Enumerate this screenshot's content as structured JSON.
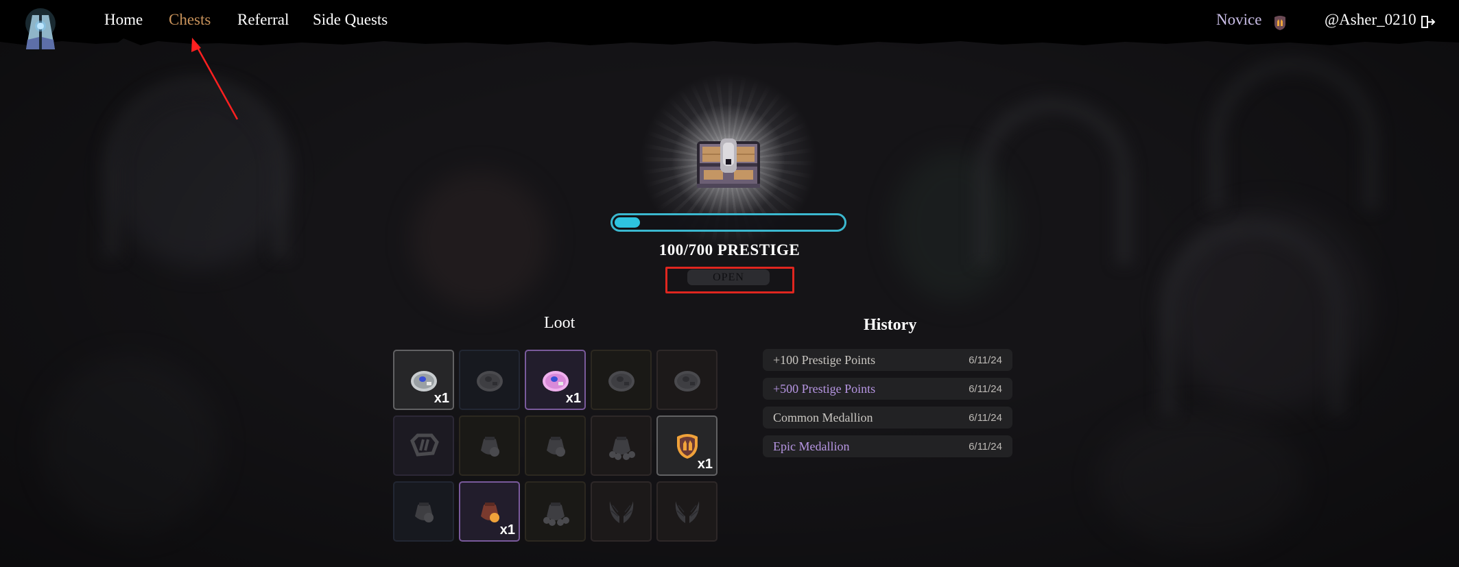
{
  "header": {
    "logo_icon": "pillar-gate-logo-icon",
    "nav": [
      {
        "label": "Home",
        "active": false
      },
      {
        "label": "Chests",
        "active": true
      },
      {
        "label": "Referral",
        "active": false
      },
      {
        "label": "Side Quests",
        "active": false
      }
    ],
    "rank": "Novice",
    "rank_badge_icon": "novice-shield-icon",
    "username": "@Asher_0210",
    "logout_icon": "logout-icon"
  },
  "chest": {
    "icon": "treasure-chest-icon",
    "progress": {
      "current": 100,
      "max": 700,
      "fraction": 0.143
    },
    "prestige_text": "100/700 PRESTIGE",
    "open_label": "OPEN",
    "open_enabled": false
  },
  "loot": {
    "title": "Loot",
    "items": [
      {
        "icon": "common-medallion-icon",
        "owned": true,
        "qty": "x1",
        "rarity": "common"
      },
      {
        "icon": "rare-medallion-icon",
        "owned": false,
        "qty": "",
        "rarity": "rare"
      },
      {
        "icon": "epic-medallion-icon",
        "owned": true,
        "qty": "x1",
        "rarity": "epic"
      },
      {
        "icon": "legendary-medallion-icon",
        "owned": false,
        "qty": "",
        "rarity": "legendary"
      },
      {
        "icon": "mythic-medallion-icon",
        "owned": false,
        "qty": "",
        "rarity": "mythic"
      },
      {
        "icon": "rank-badge-icon",
        "owned": false,
        "qty": "",
        "rarity": "epic"
      },
      {
        "icon": "small-coin-pouch-icon",
        "owned": false,
        "qty": "",
        "rarity": "legendary"
      },
      {
        "icon": "medium-coin-pouch-icon",
        "owned": false,
        "qty": "",
        "rarity": "legendary"
      },
      {
        "icon": "large-coin-pile-icon",
        "owned": false,
        "qty": "",
        "rarity": "mythic"
      },
      {
        "icon": "novice-shield-badge-icon",
        "owned": true,
        "qty": "x1",
        "rarity": "common"
      },
      {
        "icon": "tiny-coin-pouch-icon",
        "owned": false,
        "qty": "",
        "rarity": "rare"
      },
      {
        "icon": "prestige-coin-pouch-icon",
        "owned": true,
        "qty": "x1",
        "rarity": "epic"
      },
      {
        "icon": "coin-sack-pile-icon",
        "owned": false,
        "qty": "",
        "rarity": "legendary"
      },
      {
        "icon": "wings-icon",
        "owned": false,
        "qty": "",
        "rarity": "mythic"
      },
      {
        "icon": "wings-icon",
        "owned": false,
        "qty": "",
        "rarity": "mythic"
      }
    ]
  },
  "history": {
    "title": "History",
    "entries": [
      {
        "label": "+100 Prestige Points",
        "date": "6/11/24",
        "rarity": "common"
      },
      {
        "label": "+500 Prestige Points",
        "date": "6/11/24",
        "rarity": "epic"
      },
      {
        "label": "Common Medallion",
        "date": "6/11/24",
        "rarity": "common"
      },
      {
        "label": "Epic Medallion",
        "date": "6/11/24",
        "rarity": "epic"
      }
    ]
  },
  "colors": {
    "active_nav": "#c9935b",
    "progress": "#2ec3df",
    "epic": "#b796e3",
    "annotation": "#e0261f"
  }
}
